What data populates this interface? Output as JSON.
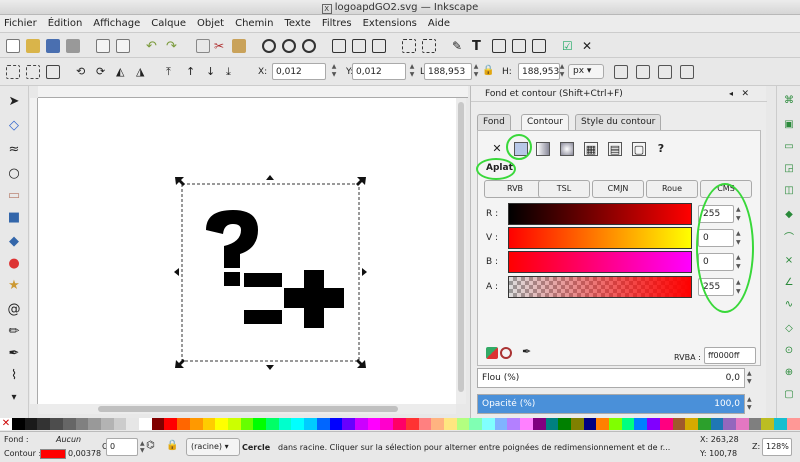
{
  "window": {
    "title": "logoapdGO2.svg — Inkscape"
  },
  "menu": [
    "Fichier",
    "Édition",
    "Affichage",
    "Calque",
    "Objet",
    "Chemin",
    "Texte",
    "Filtres",
    "Extensions",
    "Aide"
  ],
  "controls": {
    "x_label": "X:",
    "x_value": "0,012",
    "y_label": "Y:",
    "y_value": "0,012",
    "w_label": "L:",
    "w_value": "188,953",
    "h_label": "H:",
    "h_value": "188,953",
    "unit": "px"
  },
  "panel": {
    "title": "Fond et contour (Shift+Ctrl+F)",
    "tabs": [
      "Fond",
      "Contour",
      "Style du contour"
    ],
    "paint_mode": "Aplat",
    "modes": [
      "RVB",
      "TSL",
      "CMJN",
      "Roue",
      "CMS"
    ],
    "channels": [
      {
        "label": "R :",
        "value": "255"
      },
      {
        "label": "V :",
        "value": "0"
      },
      {
        "label": "B :",
        "value": "0"
      },
      {
        "label": "A :",
        "value": "255"
      }
    ],
    "rgba_label": "RVBA :",
    "rgba_value": "ff0000ff",
    "blur_label": "Flou (%)",
    "blur_value": "0,0",
    "opacity_label": "Opacité (%)",
    "opacity_value": "100,0"
  },
  "status": {
    "fill_label": "Fond :",
    "fill_value": "Aucun",
    "stroke_label": "Contour :",
    "stroke_width": "0,00378",
    "opacity_label": "O:",
    "opacity_value": "0",
    "layer": "(racine)",
    "message_bold": "Cercle",
    "message": "dans racine. Cliquer sur la sélection pour alterner entre poignées de redimensionnement et de r...",
    "cursor_x": "X: 263,28",
    "cursor_y": "Y: 100,78",
    "zoom_label": "Z:",
    "zoom": "128%",
    "stroke_color": "#ff0000"
  },
  "palette": [
    "#000000",
    "#1a1a1a",
    "#333333",
    "#4d4d4d",
    "#666666",
    "#808080",
    "#999999",
    "#b3b3b3",
    "#cccccc",
    "#e6e6e6",
    "#ffffff",
    "#800000",
    "#ff0000",
    "#ff6600",
    "#ff9900",
    "#ffcc00",
    "#ffff00",
    "#ccff00",
    "#66ff00",
    "#00ff00",
    "#00ff66",
    "#00ffcc",
    "#00ffff",
    "#00ccff",
    "#0066ff",
    "#0000ff",
    "#6600ff",
    "#cc00ff",
    "#ff00ff",
    "#ff00cc",
    "#ff0066",
    "#ff3333",
    "#ff8080",
    "#ffb380",
    "#ffe680",
    "#b3ff80",
    "#80ffb3",
    "#80ffff",
    "#80b3ff",
    "#b380ff",
    "#ff80ff",
    "#800080",
    "#008080",
    "#008000",
    "#808000",
    "#000080",
    "#ff8000",
    "#80ff00",
    "#00ff80",
    "#0080ff",
    "#8000ff",
    "#ff0080",
    "#a05a2c",
    "#d4aa00",
    "#2ca02c",
    "#1f77b4",
    "#9467bd",
    "#e377c2",
    "#7f7f7f",
    "#bcbd22",
    "#17becf",
    "#ff9896"
  ]
}
